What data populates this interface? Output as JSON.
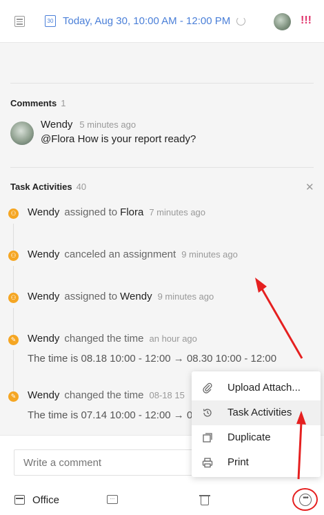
{
  "header": {
    "date_range": "Today, Aug 30, 10:00 AM - 12:00 PM",
    "calendar_day": "30",
    "priority": "!!!",
    "icons": [
      "list-icon",
      "calendar-icon",
      "refresh-icon",
      "avatar",
      "priority-icon"
    ]
  },
  "comments": {
    "title": "Comments",
    "count": "1",
    "items": [
      {
        "author": "Wendy",
        "time": "5 minutes ago",
        "text": "@Flora How is your report ready?"
      }
    ]
  },
  "activities": {
    "title": "Task Activities",
    "count": "40",
    "items": [
      {
        "who": "Wendy",
        "verb": "assigned to",
        "target": "Flora",
        "when": "7 minutes ago",
        "icon": "assign-icon"
      },
      {
        "who": "Wendy",
        "verb": "canceled an assignment",
        "target": "",
        "when": "9 minutes ago",
        "icon": "assign-icon"
      },
      {
        "who": "Wendy",
        "verb": "assigned to",
        "target": "Wendy",
        "when": "9 minutes ago",
        "icon": "assign-icon"
      },
      {
        "who": "Wendy",
        "verb": "changed the time",
        "target": "",
        "when": "an hour ago",
        "detail": "The time is 08.18 10:00 - 12:00 → 08.30 10:00 - 12:00",
        "icon": "pencil-icon"
      },
      {
        "who": "Wendy",
        "verb": "changed the time",
        "target": "",
        "when": "08-18 15",
        "detail": "The time is 07.14 10:00 - 12:00 → 0",
        "icon": "pencil-icon"
      }
    ]
  },
  "menu": {
    "items": [
      {
        "label": "Upload Attach...",
        "icon": "paperclip-icon"
      },
      {
        "label": "Task Activities",
        "icon": "history-icon"
      },
      {
        "label": "Duplicate",
        "icon": "duplicate-icon"
      },
      {
        "label": "Print",
        "icon": "print-icon"
      }
    ]
  },
  "footer": {
    "comment_placeholder": "Write a comment",
    "list_name": "Office"
  },
  "colors": {
    "accent": "#4a7fd8",
    "priority": "#e0336b",
    "activity_icon": "#f5a623",
    "annotation": "#e52020"
  }
}
